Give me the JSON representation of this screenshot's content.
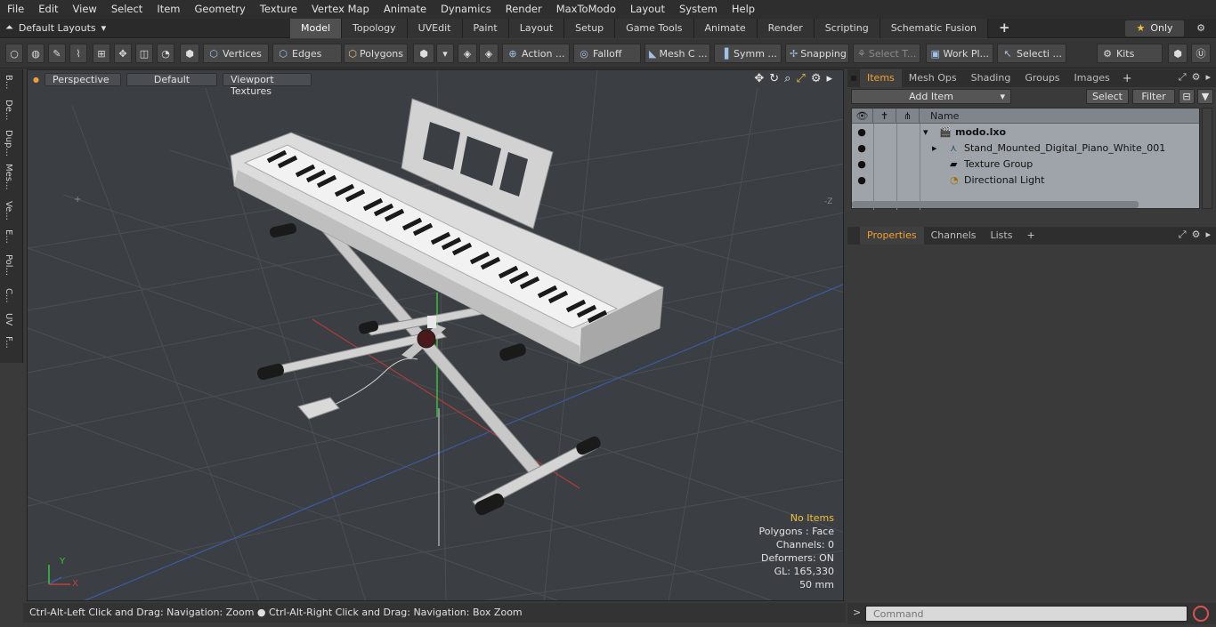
{
  "menu": [
    "File",
    "Edit",
    "View",
    "Select",
    "Item",
    "Geometry",
    "Texture",
    "Vertex Map",
    "Animate",
    "Dynamics",
    "Render",
    "MaxToModo",
    "Layout",
    "System",
    "Help"
  ],
  "layouts": {
    "label": "Default Layouts"
  },
  "layout_tabs": [
    "Model",
    "Topology",
    "UVEdit",
    "Paint",
    "Layout",
    "Setup",
    "Game Tools",
    "Animate",
    "Render",
    "Scripting",
    "Schematic Fusion"
  ],
  "layout_tab_active": "Model",
  "only_label": "Only",
  "toolbar": {
    "vertices": "Vertices",
    "edges": "Edges",
    "polygons": "Polygons",
    "action": "Action ...",
    "falloff": "Falloff",
    "mesh": "Mesh C ...",
    "symm": "Symm ...",
    "snapping": "Snapping",
    "select_t": "Select T...",
    "work_pl": "Work Pl...",
    "selecti": "Selecti ...",
    "kits": "Kits"
  },
  "left_strip": [
    "B...",
    "De...",
    "Dup...",
    "Mes...",
    "Ve...",
    "E...",
    "Pol...",
    "C...",
    "UV",
    "F..."
  ],
  "viewport": {
    "view": "Perspective",
    "shading": "Default",
    "textures": "Viewport Textures",
    "stats": {
      "no_items": "No Items",
      "polygons": "Polygons : Face",
      "channels": "Channels: 0",
      "deformers": "Deformers: ON",
      "gl": "GL: 165,330",
      "mm": "50 mm"
    },
    "axis_y": "Y",
    "axis_x": "X"
  },
  "status": "Ctrl-Alt-Left Click and Drag: Navigation: Zoom ● Ctrl-Alt-Right Click and Drag: Navigation: Box Zoom",
  "item_tabs": [
    "Items",
    "Mesh Ops",
    "Shading",
    "Groups",
    "Images"
  ],
  "item_tab_active": "Items",
  "add_item": "Add Item",
  "select_btn": "Select",
  "filter_btn": "Filter",
  "tree": {
    "header": "Name",
    "rows": [
      {
        "label": "modo.lxo",
        "icon": "scene-icon"
      },
      {
        "label": "Stand_Mounted_Digital_Piano_White_001",
        "icon": "mesh-icon"
      },
      {
        "label": "Texture Group",
        "icon": "texture-group-icon"
      },
      {
        "label": "Directional Light",
        "icon": "light-icon"
      }
    ]
  },
  "prop_tabs": [
    "Properties",
    "Channels",
    "Lists"
  ],
  "prop_tab_active": "Properties",
  "command_placeholder": "Command"
}
